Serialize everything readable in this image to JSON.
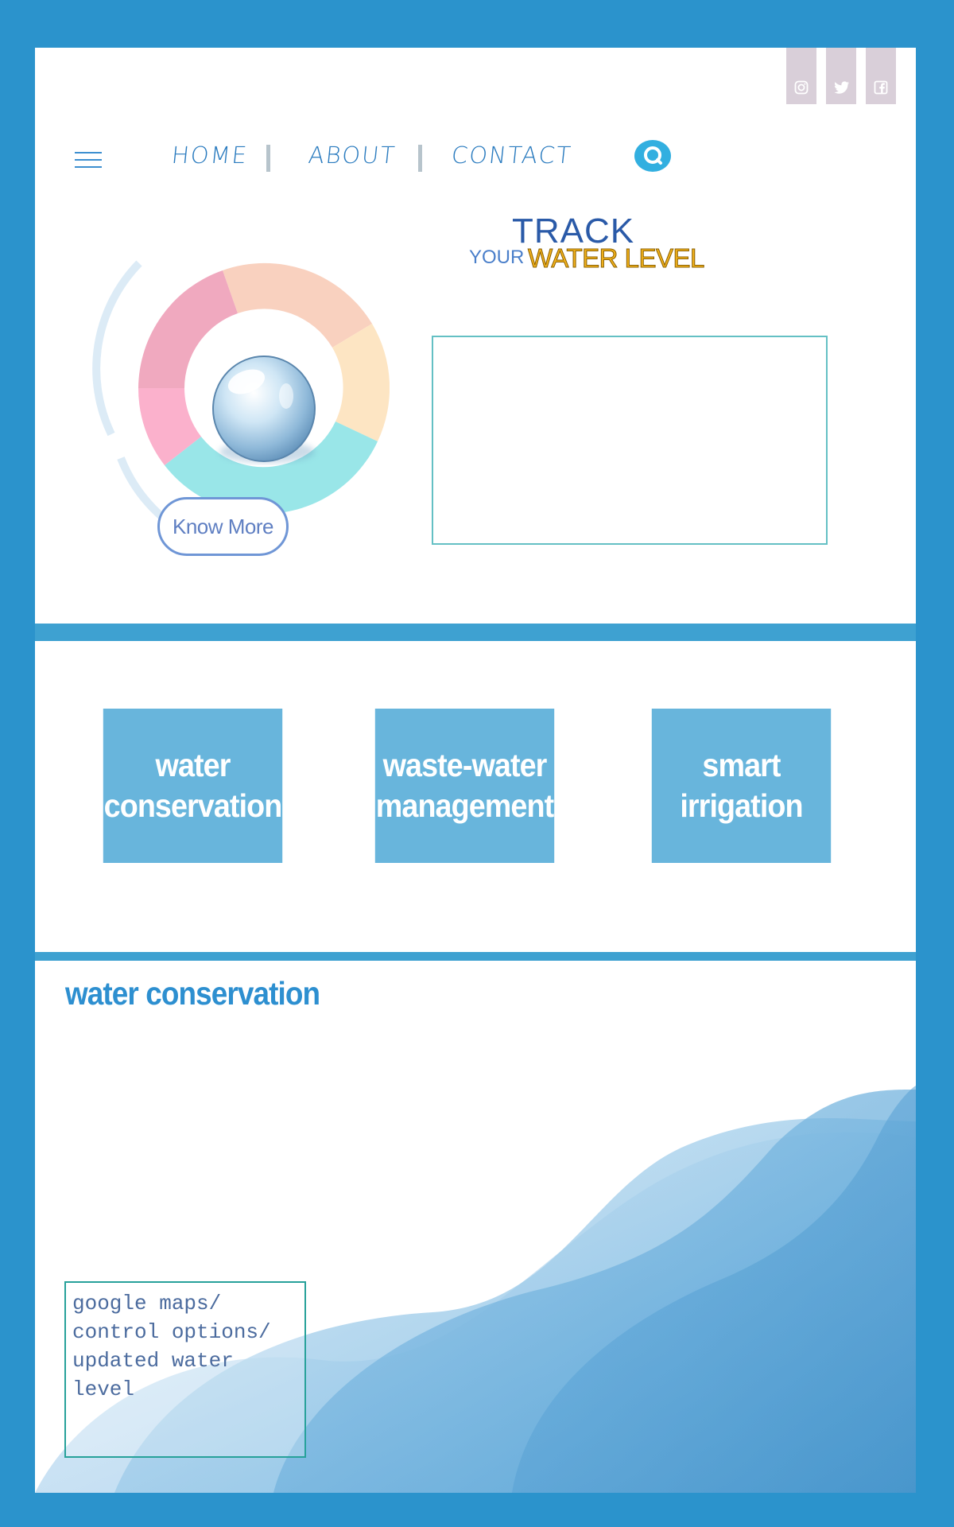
{
  "nav": {
    "menu_icon": "hamburger-icon",
    "links": [
      "HOME",
      "ABOUT",
      "CONTACT"
    ],
    "search_icon": "search-icon",
    "social_icons": [
      "instagram-icon",
      "twitter-icon",
      "facebook-icon"
    ]
  },
  "hero": {
    "button_label": "Know More",
    "title_line1": "TRACK",
    "title_your": "YOUR",
    "title_line2": "WATER LEVEL"
  },
  "features": {
    "tiles": [
      "water conservation",
      "waste-water management",
      "smart irrigation"
    ],
    "tile_lines": [
      [
        "water",
        "conservation"
      ],
      [
        "waste-water",
        "management"
      ],
      [
        "smart",
        "irrigation"
      ]
    ]
  },
  "section": {
    "title": "water conservation",
    "box_lines": [
      "google maps/",
      "control options/",
      "updated water",
      "level"
    ]
  },
  "colors": {
    "frame": "#2b93cc",
    "accent": "#3ea1d1",
    "tile": "#68b5dc",
    "title_blue": "#2a5aa8",
    "title_gold": "#f2b21b"
  }
}
